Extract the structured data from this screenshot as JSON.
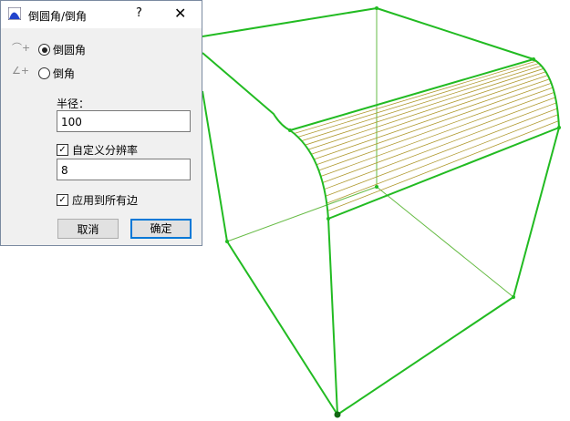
{
  "dialog": {
    "title": "倒圆角/倒角",
    "help": "?",
    "close": "✕",
    "options": [
      {
        "label": "倒圆角",
        "selected": true
      },
      {
        "label": "倒角",
        "selected": false
      }
    ],
    "radius_label": "半径：",
    "radius_value": "100",
    "custom_resolution_label": "自定义分辨率",
    "custom_resolution_checked": true,
    "resolution_value": "8",
    "apply_all_label": "应用到所有边",
    "apply_all_checked": true,
    "cancel": "取消",
    "ok": "确定"
  },
  "colors": {
    "edge": "#22bb22",
    "thin": "#66bb44",
    "hatch": "#b09a30",
    "accent": "#0078d7"
  }
}
